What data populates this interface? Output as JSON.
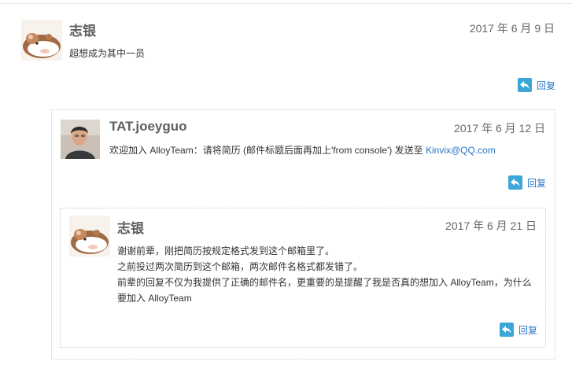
{
  "comments": [
    {
      "author": "志银",
      "date": "2017 年 6 月 9 日",
      "lines": [
        "超想成为其中一员"
      ],
      "reply_label": "回复"
    },
    {
      "author": "TAT.joeyguo",
      "date": "2017 年 6 月 12 日",
      "text_before": "欢迎加入 AlloyTeam：请将简历 (邮件标题后面再加上'from console') 发送至 ",
      "email": "Kinvix@QQ.com",
      "reply_label": "回复"
    },
    {
      "author": "志银",
      "date": "2017 年 6 月 21 日",
      "lines": [
        "谢谢前辈，刚把简历按规定格式发到这个邮箱里了。",
        "之前投过两次简历到这个邮箱，两次邮件名格式都发错了。",
        "前辈的回复不仅为我提供了正确的邮件名，更重要的是提醒了我是否真的想加入 AlloyTeam，为什么",
        "要加入 AlloyTeam"
      ],
      "reply_label": "回复"
    }
  ],
  "colors": {
    "link": "#2a77c7",
    "reply_icon_bg": "#3ba6d8",
    "author": "#5f5f5f"
  },
  "icons": {
    "reply": "reply-arrow-icon",
    "avatar1": "hamster-avatar",
    "avatar2": "person-avatar"
  }
}
